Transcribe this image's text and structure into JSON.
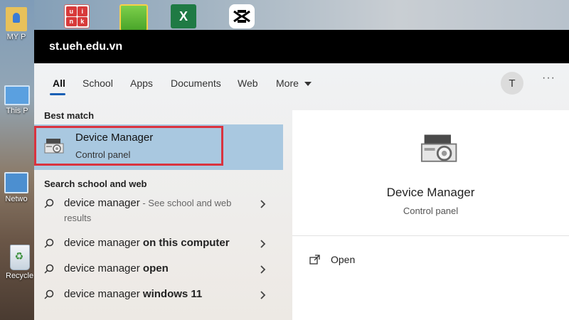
{
  "desktop": {
    "icons": [
      {
        "label": "MY P",
        "icon": "user-folder-icon"
      },
      {
        "label": "This P",
        "icon": "this-pc-icon"
      },
      {
        "label": "Netwo",
        "icon": "network-icon"
      },
      {
        "label": "Recycle",
        "icon": "recycle-bin-icon"
      }
    ],
    "taskbar_apps": [
      {
        "icon": "unikey-icon",
        "glyphs": [
          "u",
          "i",
          "n",
          "k"
        ]
      },
      {
        "icon": "green-app-icon"
      },
      {
        "icon": "excel-icon",
        "glyph": "X"
      },
      {
        "icon": "capcut-icon"
      }
    ]
  },
  "window": {
    "title": "st.ueh.edu.vn"
  },
  "tabs": [
    {
      "label": "All",
      "active": true
    },
    {
      "label": "School"
    },
    {
      "label": "Apps"
    },
    {
      "label": "Documents"
    },
    {
      "label": "Web"
    },
    {
      "label": "More",
      "icon": "caret-down-icon"
    }
  ],
  "avatar_initial": "T",
  "more_options": "···",
  "best_match": {
    "header": "Best match",
    "name": "Device Manager",
    "type": "Control panel",
    "icon": "device-manager-icon",
    "highlight_color": "#d9333f"
  },
  "search_web": {
    "header": "Search school and web",
    "results": [
      {
        "prefix": "device manager",
        "bold": "",
        "hint": " - See school and web",
        "hint2": "results"
      },
      {
        "prefix": "device manager ",
        "bold": "on this computer"
      },
      {
        "prefix": "device manager ",
        "bold": "open"
      },
      {
        "prefix": "device manager ",
        "bold": "windows 11"
      }
    ]
  },
  "preview": {
    "name": "Device Manager",
    "type": "Control panel",
    "actions": [
      {
        "label": "Open",
        "icon": "open-icon"
      }
    ]
  }
}
